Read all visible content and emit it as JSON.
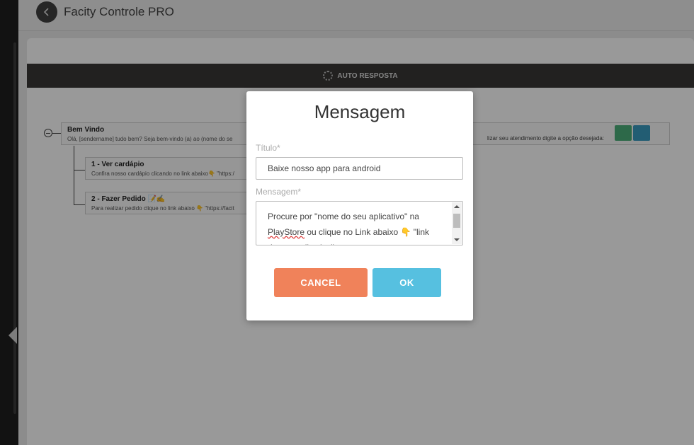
{
  "app": {
    "title": "Facity Controle PRO"
  },
  "panel": {
    "header_label": "AUTO RESPOSTA"
  },
  "tree": {
    "root": {
      "title": "Bem Vindo",
      "message": "Olá, [sendername] tudo bem? Seja bem-vindo (a) ao (nome do se",
      "message_tail": "lizar seu atendimento digite a opção desejada:"
    },
    "children": [
      {
        "title": "1 - Ver cardápio",
        "message": "Confira nosso cardápio clicando no link abaixo👇 \"https:/"
      },
      {
        "title": "2 - Fazer Pedido 📝✍",
        "message": "Para realizar pedido clique no link abaixo 👇 \"https://facit"
      }
    ]
  },
  "modal": {
    "title": "Mensagem",
    "titulo_label": "Título*",
    "titulo_value": "Baixe nosso app para android",
    "mensagem_label": "Mensagem*",
    "mensagem_line1": "Procure por \"nome do seu aplicativo\" na",
    "mensagem_word_spell": "PlayStore",
    "mensagem_line2_rest": " ou clique no Link abaixo 👇 \"link",
    "mensagem_line3": "do seu aplicativo\"",
    "cancel_label": "CANCEL",
    "ok_label": "OK"
  },
  "colors": {
    "cancel": "#f0825a",
    "ok": "#56c0e0",
    "edit_action": "#4caf7a",
    "list_action": "#3a9bc0"
  }
}
